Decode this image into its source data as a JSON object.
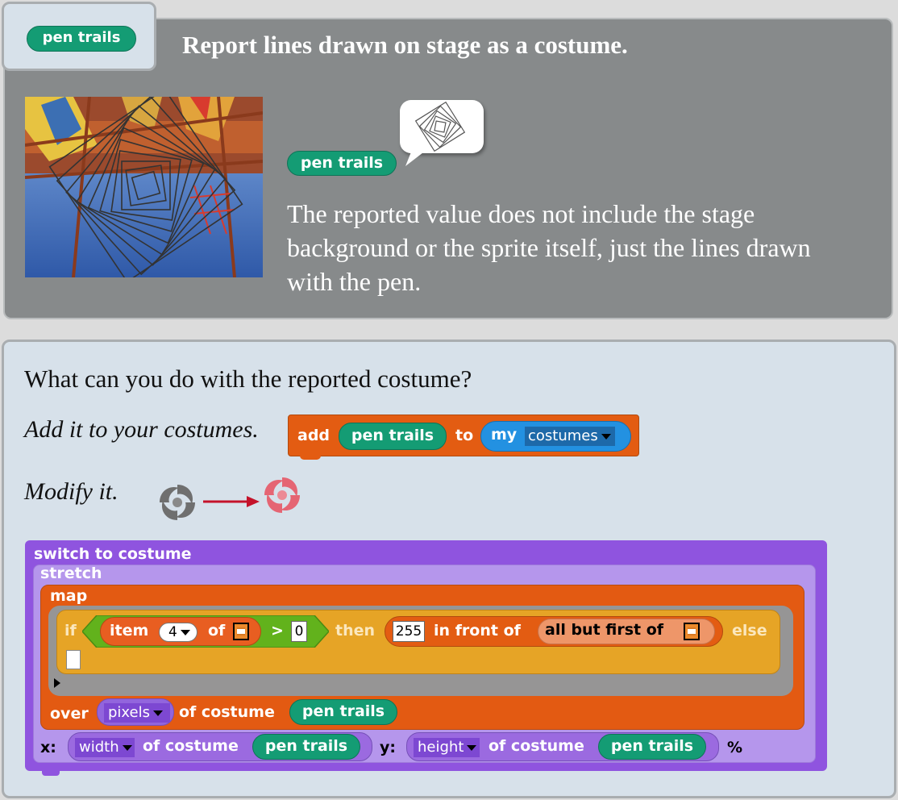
{
  "top": {
    "tab_block": "pen trails",
    "title": "Report lines drawn on stage as a costume.",
    "demo_block": "pen trails",
    "description": "The reported value does not include the stage background or the sprite itself, just the lines drawn with the pen."
  },
  "bottom": {
    "question": "What can you do with the reported costume?",
    "add_caption": "Add it to your costumes.",
    "modify_caption": "Modify it.",
    "add_block": {
      "add_label": "add",
      "pen_trails": "pen trails",
      "to_label": "to",
      "my_label": "my",
      "costumes_option": "costumes"
    },
    "script": {
      "switch_label": "switch to costume",
      "stretch_label": "stretch",
      "map_label": "map",
      "if_label": "if",
      "item_label": "item",
      "item_index": "4",
      "of_label": "of",
      "gt_symbol": ">",
      "zero_value": "0",
      "then_label": "then",
      "value_255": "255",
      "in_front_of": "in front of",
      "all_but_first": "all but first of",
      "else_label": "else",
      "over_label": "over",
      "pixels_option": "pixels",
      "of_costume": "of costume",
      "pen_trails": "pen trails",
      "x_label": "x:",
      "width_option": "width",
      "y_label": "y:",
      "height_option": "height",
      "percent": "%"
    }
  },
  "colors": {
    "top_panel": "#878a8b",
    "bottom_panel": "#d7e1ea",
    "pen_green": "#149c74",
    "control_orange": "#e35c12",
    "looks_purple": "#8f54df",
    "operators_green": "#62b21c",
    "if_yellow": "#e6a426",
    "variables_blue": "#2391e1",
    "arrow_red": "#c4122a"
  }
}
